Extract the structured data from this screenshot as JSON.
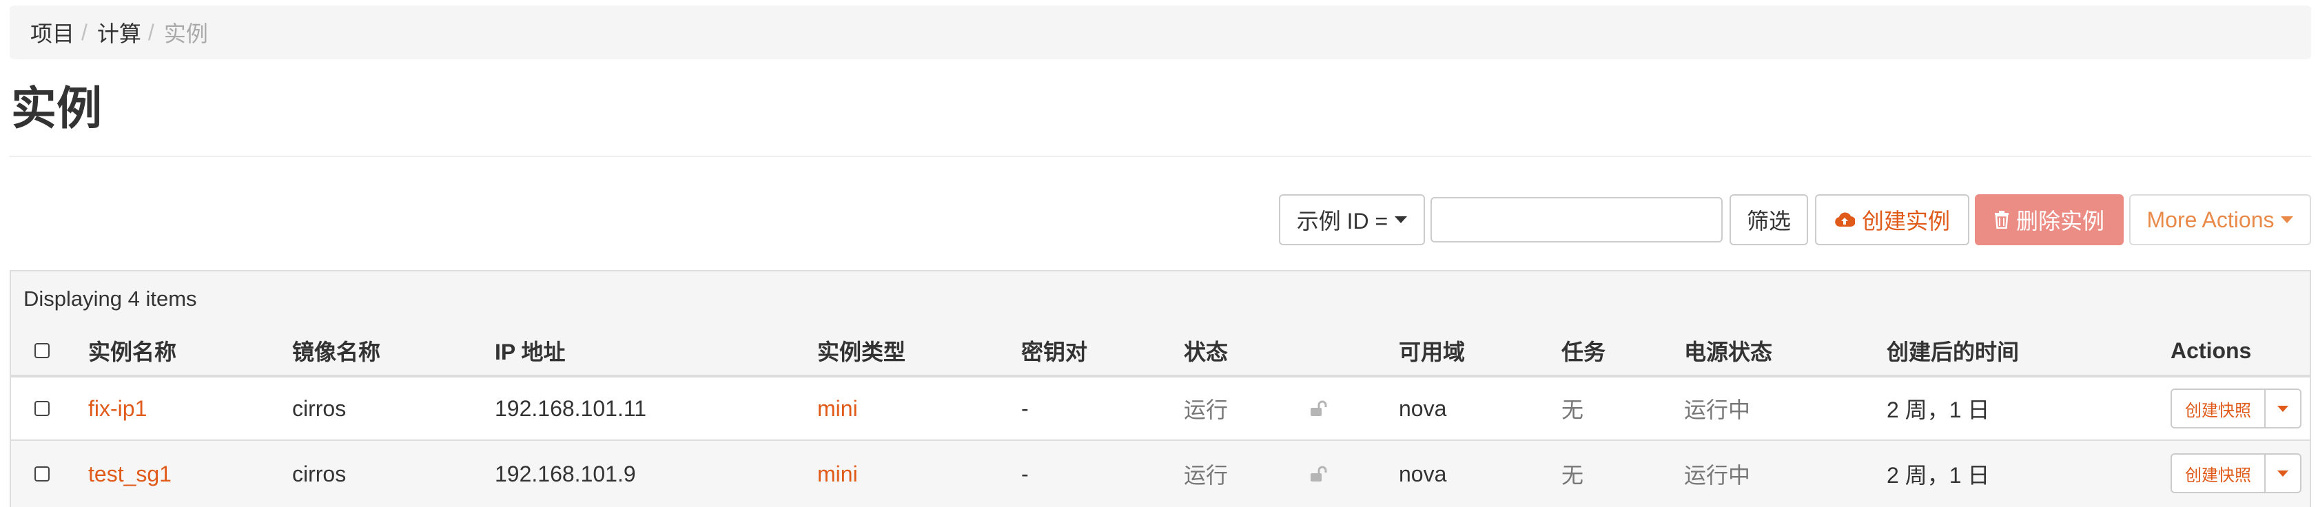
{
  "breadcrumb": {
    "items": [
      "项目",
      "计算",
      "实例"
    ],
    "separator": "/"
  },
  "page": {
    "title": "实例"
  },
  "toolbar": {
    "filter_dropdown_label": "示例 ID =",
    "filter_input_value": "",
    "filter_button_label": "筛选",
    "create_label": "创建实例",
    "delete_label": "删除实例",
    "more_label": "More Actions",
    "icons": {
      "create": "cloud-upload-icon",
      "delete": "trash-icon",
      "caret": "caret-down-icon"
    }
  },
  "table": {
    "count_text": "Displaying 4 items",
    "columns": [
      "实例名称",
      "镜像名称",
      "IP 地址",
      "实例类型",
      "密钥对",
      "状态",
      "可用域",
      "任务",
      "电源状态",
      "创建后的时间",
      "Actions"
    ],
    "rows": [
      {
        "name": "fix-ip1",
        "image": "cirros",
        "ip": "192.168.101.11",
        "flavor": "mini",
        "keypair": "-",
        "status": "运行",
        "lock_icon": "unlock-icon",
        "az": "nova",
        "task": "无",
        "power": "运行中",
        "age": "2 周，1 日",
        "action": "创建快照"
      },
      {
        "name": "test_sg1",
        "image": "cirros",
        "ip": "192.168.101.9",
        "flavor": "mini",
        "keypair": "-",
        "status": "运行",
        "lock_icon": "unlock-icon",
        "az": "nova",
        "task": "无",
        "power": "运行中",
        "age": "2 周，1 日",
        "action": "创建快照"
      }
    ]
  },
  "colors": {
    "accent": "#e05a1a",
    "danger": "#ec8d85",
    "muted": "#777777"
  }
}
